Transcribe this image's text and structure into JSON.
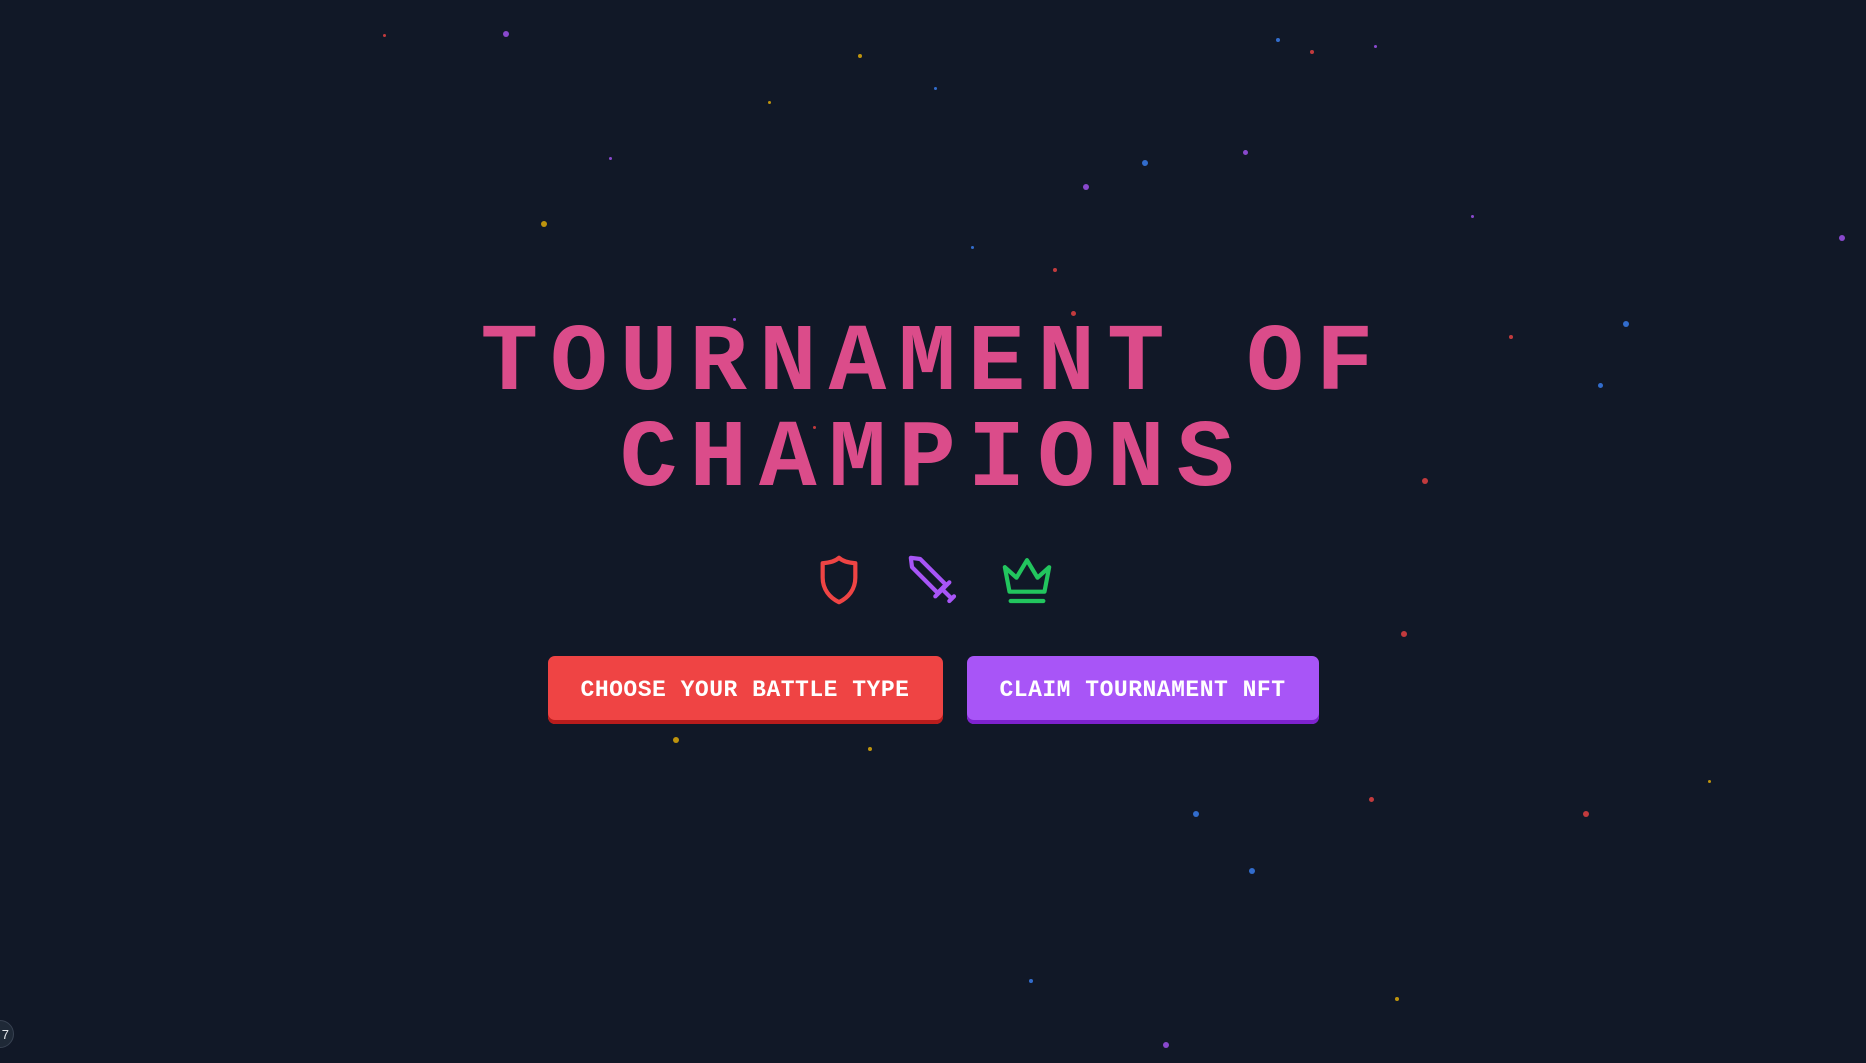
{
  "page": {
    "background_color": "#111827",
    "title_lines": [
      "TOURNAMENT OF",
      "CHAMPIONS"
    ],
    "title_color": "#db4c8a"
  },
  "icons": [
    {
      "name": "shield-icon",
      "color": "#ef4444"
    },
    {
      "name": "sword-icon",
      "color": "#a855f7"
    },
    {
      "name": "crown-icon",
      "color": "#22c55e"
    }
  ],
  "buttons": {
    "battle_type_label": "CHOOSE YOUR BATTLE TYPE",
    "battle_type_color": "#ef4444",
    "claim_nft_label": "CLAIM TOURNAMENT NFT",
    "claim_nft_color": "#a855f7"
  },
  "corner_badge": {
    "text": "7"
  },
  "particle_colors": [
    "#a855f7",
    "#ef4444",
    "#eab308",
    "#3b82f6"
  ]
}
